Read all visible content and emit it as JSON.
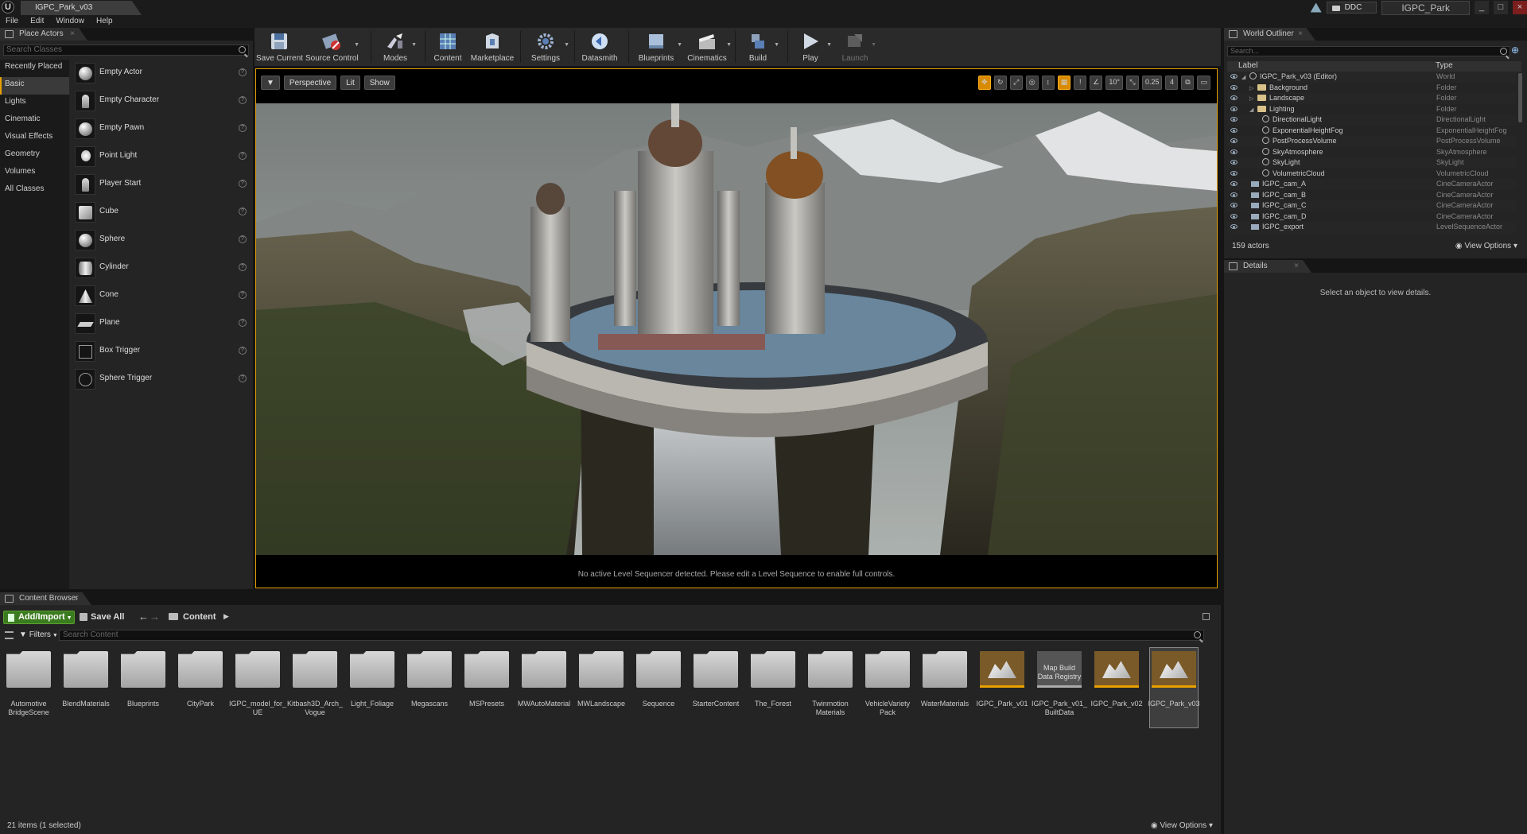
{
  "window": {
    "document_tab": "IGPC_Park_v03",
    "ddc_label": "DDC",
    "project_name": "IGPC_Park",
    "win_min": "_",
    "win_max": "□",
    "win_close": "×"
  },
  "menu": [
    "File",
    "Edit",
    "Window",
    "Help"
  ],
  "place_actors": {
    "tab": "Place Actors",
    "search_placeholder": "Search Classes",
    "categories": [
      "Recently Placed",
      "Basic",
      "Lights",
      "Cinematic",
      "Visual Effects",
      "Geometry",
      "Volumes",
      "All Classes"
    ],
    "actors": [
      "Empty Actor",
      "Empty Character",
      "Empty Pawn",
      "Point Light",
      "Player Start",
      "Cube",
      "Sphere",
      "Cylinder",
      "Cone",
      "Plane",
      "Box Trigger",
      "Sphere Trigger"
    ],
    "help": "?"
  },
  "toolbar": {
    "items": [
      "Save Current",
      "Source Control",
      "Modes",
      "Content",
      "Marketplace",
      "Settings",
      "Datasmith",
      "Blueprints",
      "Cinematics",
      "Build",
      "Play",
      "Launch"
    ],
    "dropdown": "▼"
  },
  "viewport": {
    "perspective": "Perspective",
    "lit": "Lit",
    "show": "Show",
    "angle_snap": "10°",
    "scale_snap": "0.25",
    "camera_speed": "4",
    "message": "No active Level Sequencer detected. Please edit a Level Sequence to enable full controls."
  },
  "world_outliner": {
    "tab": "World Outliner",
    "search_placeholder": "Search...",
    "col_label": "Label",
    "col_type": "Type",
    "rows": [
      {
        "label": "IGPC_Park_v03 (Editor)",
        "type": "World"
      },
      {
        "label": "Background",
        "type": "Folder"
      },
      {
        "label": "Landscape",
        "type": "Folder"
      },
      {
        "label": "Lighting",
        "type": "Folder"
      },
      {
        "label": "DirectionalLight",
        "type": "DirectionalLight"
      },
      {
        "label": "ExponentialHeightFog",
        "type": "ExponentialHeightFog"
      },
      {
        "label": "PostProcessVolume",
        "type": "PostProcessVolume"
      },
      {
        "label": "SkyAtmosphere",
        "type": "SkyAtmosphere"
      },
      {
        "label": "SkyLight",
        "type": "SkyLight"
      },
      {
        "label": "VolumetricCloud",
        "type": "VolumetricCloud"
      },
      {
        "label": "IGPC_cam_A",
        "type": "CineCameraActor"
      },
      {
        "label": "IGPC_cam_B",
        "type": "CineCameraActor"
      },
      {
        "label": "IGPC_cam_C",
        "type": "CineCameraActor"
      },
      {
        "label": "IGPC_cam_D",
        "type": "CineCameraActor"
      },
      {
        "label": "IGPC_export",
        "type": "LevelSequenceActor"
      }
    ],
    "count": "159 actors",
    "view_options": "View Options"
  },
  "details": {
    "tab": "Details",
    "message": "Select an object to view details."
  },
  "content_browser": {
    "tab": "Content Browser",
    "add_import": "Add/Import",
    "save_all": "Save All",
    "breadcrumb": "Content",
    "filters": "Filters",
    "search_placeholder": "Search Content",
    "assets": [
      {
        "name": "Automotive BridgeScene",
        "kind": "folder"
      },
      {
        "name": "BlendMaterials",
        "kind": "folder"
      },
      {
        "name": "Blueprints",
        "kind": "folder"
      },
      {
        "name": "CityPark",
        "kind": "folder"
      },
      {
        "name": "IGPC_model_for_ UE",
        "kind": "folder"
      },
      {
        "name": "Kitbash3D_Arch_ Vogue",
        "kind": "folder"
      },
      {
        "name": "Light_Foliage",
        "kind": "folder"
      },
      {
        "name": "Megascans",
        "kind": "folder"
      },
      {
        "name": "MSPresets",
        "kind": "folder"
      },
      {
        "name": "MWAutoMaterial",
        "kind": "folder"
      },
      {
        "name": "MWLandscape",
        "kind": "folder"
      },
      {
        "name": "Sequence",
        "kind": "folder"
      },
      {
        "name": "StarterContent",
        "kind": "folder"
      },
      {
        "name": "The_Forest",
        "kind": "folder"
      },
      {
        "name": "Twinmotion Materials",
        "kind": "folder"
      },
      {
        "name": "VehicleVariety Pack",
        "kind": "folder"
      },
      {
        "name": "WaterMaterials",
        "kind": "folder"
      },
      {
        "name": "IGPC_Park_v01",
        "kind": "map"
      },
      {
        "name": "IGPC_Park_v01_ BuiltData",
        "kind": "registry",
        "thumb_text": "Map Build Data Registry"
      },
      {
        "name": "IGPC_Park_v02",
        "kind": "map"
      },
      {
        "name": "IGPC_Park_v03",
        "kind": "map",
        "selected": true
      }
    ],
    "count": "21 items (1 selected)",
    "view_options": "View Options"
  },
  "colors": {
    "accent": "#e8a000",
    "add_import_green": "#3b7b1f"
  }
}
